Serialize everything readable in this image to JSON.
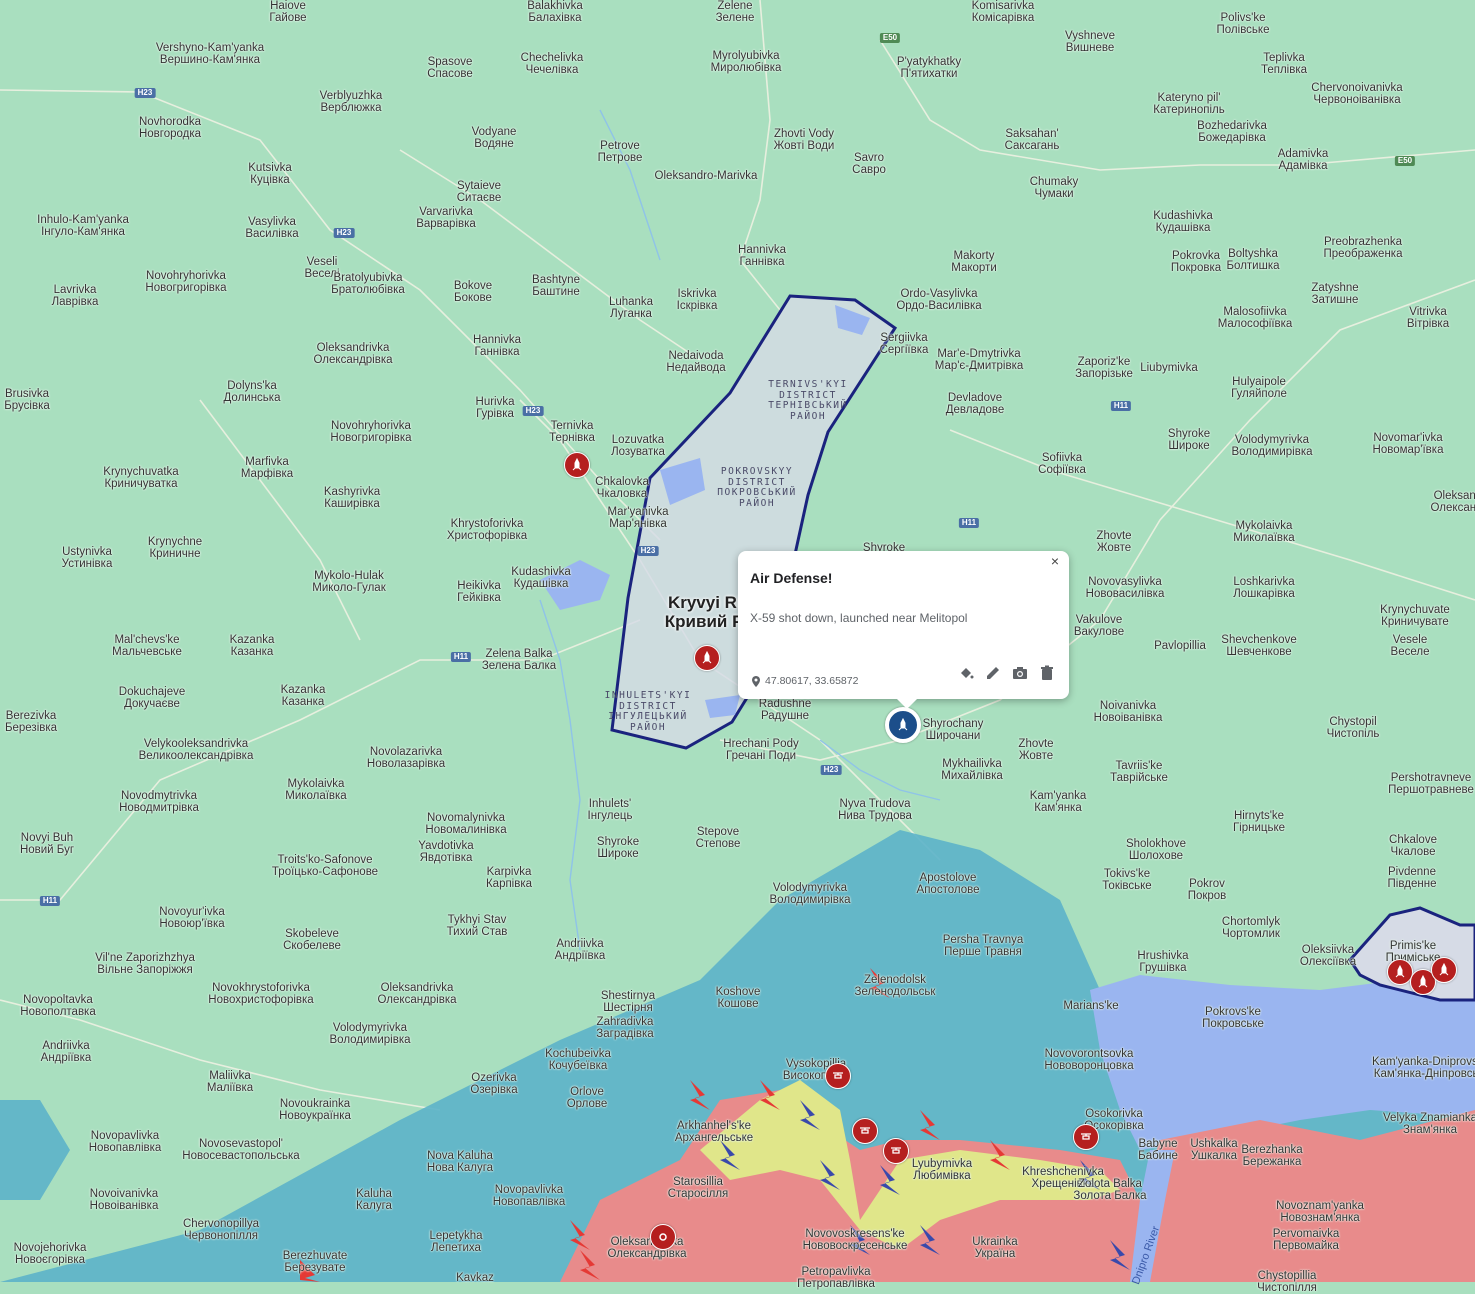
{
  "map": {
    "colors": {
      "land": "#a9dfbf",
      "ukraine_controlled_area": "#5cb3c9",
      "occupied_area": "#e88b8b",
      "contested_area": "#e0e68a",
      "reservoir": "#9ab5f0",
      "urban": "#d6dbe6",
      "selection_outline": "#1a237e",
      "marker_red": "#b51f1f",
      "marker_blue": "#1c4e8a",
      "attack_arrow_red": "#e53935",
      "attack_arrow_blue": "#3949ab"
    },
    "city": {
      "en": "Kryvyi Rih",
      "uk": "Кривий Ріг"
    },
    "districts": [
      {
        "en": "TERNIVS'KYI DISTRICT",
        "uk": "ТЕРНІВСЬКИЙ РАЙОН",
        "l1": "TERNIVS'KYI",
        "l2": "DISTRICT",
        "l3": "ТЕРНІВСЬКИЙ",
        "l4": "РАЙОН"
      },
      {
        "l1": "POKROVSKYY",
        "l2": "DISTRICT",
        "l3": "ПОКРОВСЬКИЙ",
        "l4": "РАЙОН"
      },
      {
        "l1": "INHULETS'KYI",
        "l2": "DISTRICT",
        "l3": "ІНГУЛЕЦЬКИЙ",
        "l4": "РАЙОН"
      }
    ],
    "roads": [
      "H23",
      "H23",
      "H23",
      "H23",
      "H23",
      "H11",
      "H11",
      "H11",
      "H11",
      "E50",
      "E50"
    ],
    "river_label": "Dnipro River",
    "places": [
      [
        "Haiove",
        "Гайове"
      ],
      [
        "Balakhivka",
        "Балахівка"
      ],
      [
        "Zelene",
        "Зелене"
      ],
      [
        "Komisarivka",
        "Комісарівка"
      ],
      [
        "Polivs'ke",
        "Полівське"
      ],
      [
        "Vyshneve",
        "Вишневе"
      ],
      [
        "Vershyno-Kam'yanka",
        "Вершино-Кам'янка"
      ],
      [
        "Spasove",
        "Спасове"
      ],
      [
        "Chechelivka",
        "Чечелівка"
      ],
      [
        "Myrolyubivka",
        "Миролюбівка"
      ],
      [
        "P'yatykhatky",
        "П'ятихатки"
      ],
      [
        "Teplivka",
        "Теплівка"
      ],
      [
        "Verblyuzhka",
        "Верблюжка"
      ],
      [
        "Chervonoivanivka",
        "Червоноіванівка"
      ],
      [
        "Kateryno pil'",
        "Катеринопіль"
      ],
      [
        "Novhorodka",
        "Новгородка"
      ],
      [
        "Vodyane",
        "Водяне"
      ],
      [
        "Petrove",
        "Петрове"
      ],
      [
        "Zhovti Vody",
        "Жовті Води"
      ],
      [
        "Bozhedarivka",
        "Божедарівка"
      ],
      [
        "Saksahan'",
        "Саксагань"
      ],
      [
        "Savro",
        "Савро"
      ],
      [
        "Adamivka",
        "Адамівка"
      ],
      [
        "Kutsivka",
        "Куцівка"
      ],
      [
        "Oleksandro-Marivka",
        ""
      ],
      [
        "Sytaieve",
        "Ситаєве"
      ],
      [
        "Chumaky",
        "Чумаки"
      ],
      [
        "Inhulo-Kam'yanka",
        "Інгуло-Кам'янка"
      ],
      [
        "Varvarivka",
        "Варварівка"
      ],
      [
        "Vasylivka",
        "Василівка"
      ],
      [
        "Kudashivka",
        "Кудашівка"
      ],
      [
        "Hannivka",
        "Ганнівка"
      ],
      [
        "Makorty",
        "Макорти"
      ],
      [
        "Pokrovka",
        "Покровка"
      ],
      [
        "Boltyshka",
        "Болтишка"
      ],
      [
        "Preobrazhenka",
        "Преображенка"
      ],
      [
        "Veseli",
        "Веселі"
      ],
      [
        "Lavrivka",
        "Лаврівка"
      ],
      [
        "Novohryhorivka",
        "Новогригорівка"
      ],
      [
        "Bratolyubivka",
        "Братолюбівка"
      ],
      [
        "Bokove",
        "Бокове"
      ],
      [
        "Bashtyne",
        "Баштине"
      ],
      [
        "Luhanka",
        "Луганка"
      ],
      [
        "Iskrivka",
        "Іскрівка"
      ],
      [
        "Ordo-Vasylivka",
        "Ордо-Василівка"
      ],
      [
        "Zatyshne",
        "Затишне"
      ],
      [
        "Malosofiivka",
        "Малософіївка"
      ],
      [
        "Vitrivka",
        "Вітрівка"
      ],
      [
        "Sergiivka",
        "Сергіївка"
      ],
      [
        "Oleksandrivka",
        "Олександрівка"
      ],
      [
        "Hannivka",
        "Ганнівка"
      ],
      [
        "Nedaivoda",
        "Недайвода"
      ],
      [
        "Mar'e-Dmytrivka",
        "Мар'є-Дмитрівка"
      ],
      [
        "Zaporiz'ke",
        "Запорізьке"
      ],
      [
        "Liubymivka",
        ""
      ],
      [
        "Hulyaipole",
        "Гуляйполе"
      ],
      [
        "Brusivka",
        "Брусівка"
      ],
      [
        "Dolyns'ka",
        "Долинська"
      ],
      [
        "Hurivka",
        "Гурівка"
      ],
      [
        "Devladove",
        "Девладове"
      ],
      [
        "Novohryhorivka",
        "Новогригорівка"
      ],
      [
        "Ternivka",
        "Тернівка"
      ],
      [
        "Lozuvatka",
        "Лозуватка"
      ],
      [
        "Shyroke",
        "Широке"
      ],
      [
        "Volodymyrivka",
        "Володимирівка"
      ],
      [
        "Novomar'ivka",
        "Новомар'ївка"
      ],
      [
        "Sofiivka",
        "Софіївка"
      ],
      [
        "Marfivka",
        "Марфівка"
      ],
      [
        "Krynychuvatka",
        "Криничуватка"
      ],
      [
        "Chkalovka",
        "Чкаловка"
      ],
      [
        "Kashyrivka",
        "Каширівка"
      ],
      [
        "Mar'yanivka",
        "Мар'янівка"
      ],
      [
        "Oleksandrivka",
        "Олександрівка"
      ],
      [
        "Mykolaivka",
        "Миколаївка"
      ],
      [
        "Khrystoforivka",
        "Христофорівка"
      ],
      [
        "Ustynivka",
        "Устинівка"
      ],
      [
        "Krynychne",
        "Криничне"
      ],
      [
        "Shyroke",
        ""
      ],
      [
        "Zhovte",
        "Жовте"
      ],
      [
        "Mykolo-Hulak",
        "Миколо-Гулак"
      ],
      [
        "Kudashivka",
        "Кудашівка"
      ],
      [
        "Novovasylivka",
        "Нововасилівка"
      ],
      [
        "Loshkarivka",
        "Лошкарівка"
      ],
      [
        "Heikivka",
        "Гейківка"
      ],
      [
        "Krynychuvate",
        "Криничувате"
      ],
      [
        "Vakulove",
        "Вакулове"
      ],
      [
        "Kazanka",
        "Казанка"
      ],
      [
        "Mal'chevs'ke",
        "Мальчевське"
      ],
      [
        "Zelena Balka",
        "Зелена Балка"
      ],
      [
        "Shevchenkove",
        "Шевченкове"
      ],
      [
        "Pavlopillia",
        ""
      ],
      [
        "Vesele",
        "Веселе"
      ],
      [
        "Dokuchajeve",
        "Докучаєве"
      ],
      [
        "Kazanka",
        "Казанка"
      ],
      [
        "Noivanivka",
        "Новоіванівка"
      ],
      [
        "Radushne",
        "Радушне"
      ],
      [
        "Berezivka",
        "Березівка"
      ],
      [
        "Shyrochany",
        "Широчани"
      ],
      [
        "Chystopil",
        "Чистопіль"
      ],
      [
        "Velykooleksandrivka",
        "Великоолександрівка"
      ],
      [
        "Hrechani Pody",
        "Гречані Поди"
      ],
      [
        "Zhovte",
        "Жовте"
      ],
      [
        "Mykhailivka",
        "Михайлівка"
      ],
      [
        "Tavriis'ke",
        "Таврійське"
      ],
      [
        "Novolazarivka",
        "Новолазарівка"
      ],
      [
        "Mykolaivka",
        "Миколаївка"
      ],
      [
        "Novodmytrivka",
        "Новодмитрівка"
      ],
      [
        "Kam'yanka",
        "Кам'янка"
      ],
      [
        "Pershotravneve",
        "Першотравневе"
      ],
      [
        "Nyva Trudova",
        "Нива Трудова"
      ],
      [
        "Inhulets'",
        "Інгулець"
      ],
      [
        "Novomalynivka",
        "Новомалинівка"
      ],
      [
        "Hirnyts'ke",
        "Гірницьке"
      ],
      [
        "Novyi Buh",
        "Новий Буг"
      ],
      [
        "Stepove",
        "Степове"
      ],
      [
        "Shyroke",
        "Широке"
      ],
      [
        "Yavdotivka",
        "Явдотівка"
      ],
      [
        "Sholokhove",
        "Шолохове"
      ],
      [
        "Chkalove",
        "Чкалове"
      ],
      [
        "Troits'ko-Safonove",
        "Троїцько-Сафонове"
      ],
      [
        "Karpivka",
        "Карпівка"
      ],
      [
        "Apostolove",
        "Апостолове"
      ],
      [
        "Tokivs'ke",
        "Токівське"
      ],
      [
        "Pivdenne",
        "Південне"
      ],
      [
        "Volodymyrivka",
        "Володимирівка"
      ],
      [
        "Pokrov",
        "Покров"
      ],
      [
        "Novoyur'ivka",
        "Новоюр'ївка"
      ],
      [
        "Tykhyi Stav",
        "Тихий Став"
      ],
      [
        "Chortomlyk",
        "Чортомлик"
      ],
      [
        "Skobeleve",
        "Скобелеве"
      ],
      [
        "Andriivka",
        "Андріївка"
      ],
      [
        "Persha Travnya",
        "Перше Травня"
      ],
      [
        "Primis'ke",
        "Приміське"
      ],
      [
        "Oleksiivka",
        "Олексіївка"
      ],
      [
        "Hrushivka",
        "Грушівка"
      ],
      [
        "Vil'ne Zaporizhzhya",
        "Вільне Запоріжжя"
      ],
      [
        "Novokhrystoforivka",
        "Новохристофорівка"
      ],
      [
        "Oleksandrivka",
        "Олександрівка"
      ],
      [
        "Shestirnya",
        "Шестірня"
      ],
      [
        "Koshove",
        "Кошове"
      ],
      [
        "Zelenodolsk",
        "Зеленодольськ"
      ],
      [
        "Marians'ke",
        ""
      ],
      [
        "Novopoltavka",
        "Новополтавка"
      ],
      [
        "Volodymyrivka",
        "Володимирівка"
      ],
      [
        "Zahradivka",
        "Заградівка"
      ],
      [
        "Pokrovs'ke",
        "Покровське"
      ],
      [
        "Andriivka",
        "Андріївка"
      ],
      [
        "Kochubeivka",
        "Кочубеївка"
      ],
      [
        "Vysokopillia",
        "Високопілля"
      ],
      [
        "Novovorontsovka",
        "Нововоронцовка"
      ],
      [
        "Kam'yanka-Dniprovs'ka",
        "Кам'янка-Дніпровська"
      ],
      [
        "Maliivka",
        "Маліївка"
      ],
      [
        "Ozerivka",
        "Озерівка"
      ],
      [
        "Orlove",
        "Орлове"
      ],
      [
        "Novoukrainka",
        "Новоукраїнка"
      ],
      [
        "Osokorivka",
        "Осокорівка"
      ],
      [
        "Velyka Znamianka",
        "Знам'янка"
      ],
      [
        "Arkhanhel's'ke",
        "Архангельське"
      ],
      [
        "Novopavlivka",
        "Новопавлівка"
      ],
      [
        "Novosevastopol'",
        "Новосевастопольська"
      ],
      [
        "Babyne",
        "Бабине"
      ],
      [
        "Ushkalka",
        "Ушкалка"
      ],
      [
        "Berezhanka",
        "Бережанка"
      ],
      [
        "Nova Kaluha",
        "Нова Калуга"
      ],
      [
        "Lyubymivka",
        "Любимівка"
      ],
      [
        "Khreshchenivka",
        "Хрещенівка"
      ],
      [
        "Zolota Balka",
        "Золота Балка"
      ],
      [
        "Starosillia",
        "Старосілля"
      ],
      [
        "Novopavlivka",
        "Новопавлівка"
      ],
      [
        "Novoivanivka",
        "Новоіванівка"
      ],
      [
        "Kaluha",
        "Калуга"
      ],
      [
        "Novoznam'yanka",
        "Новознам'янка"
      ],
      [
        "Novovoskresens'ke",
        "Нововоскресенське"
      ],
      [
        "Ukrainka",
        "Україна"
      ],
      [
        "Chervonopillya",
        "Червонопілля"
      ],
      [
        "Lepetykha",
        "Лепетиха"
      ],
      [
        "Pervomaivka",
        "Первомайка"
      ],
      [
        "Oleksandrivka",
        "Олександрівка"
      ],
      [
        "Novojehorivka",
        "Новоєгорівка"
      ],
      [
        "Berezhuvate",
        "Березуватe"
      ],
      [
        "Petropavlivka",
        "Петропавлівка"
      ],
      [
        "Chystopillia",
        "Чистопілля"
      ],
      [
        "Kavkaz",
        ""
      ]
    ]
  },
  "popup": {
    "title": "Air Defense!",
    "description": "X-59 shot down, launched near Melitopol",
    "coords": "47.80617, 33.65872",
    "close_label": "×"
  }
}
